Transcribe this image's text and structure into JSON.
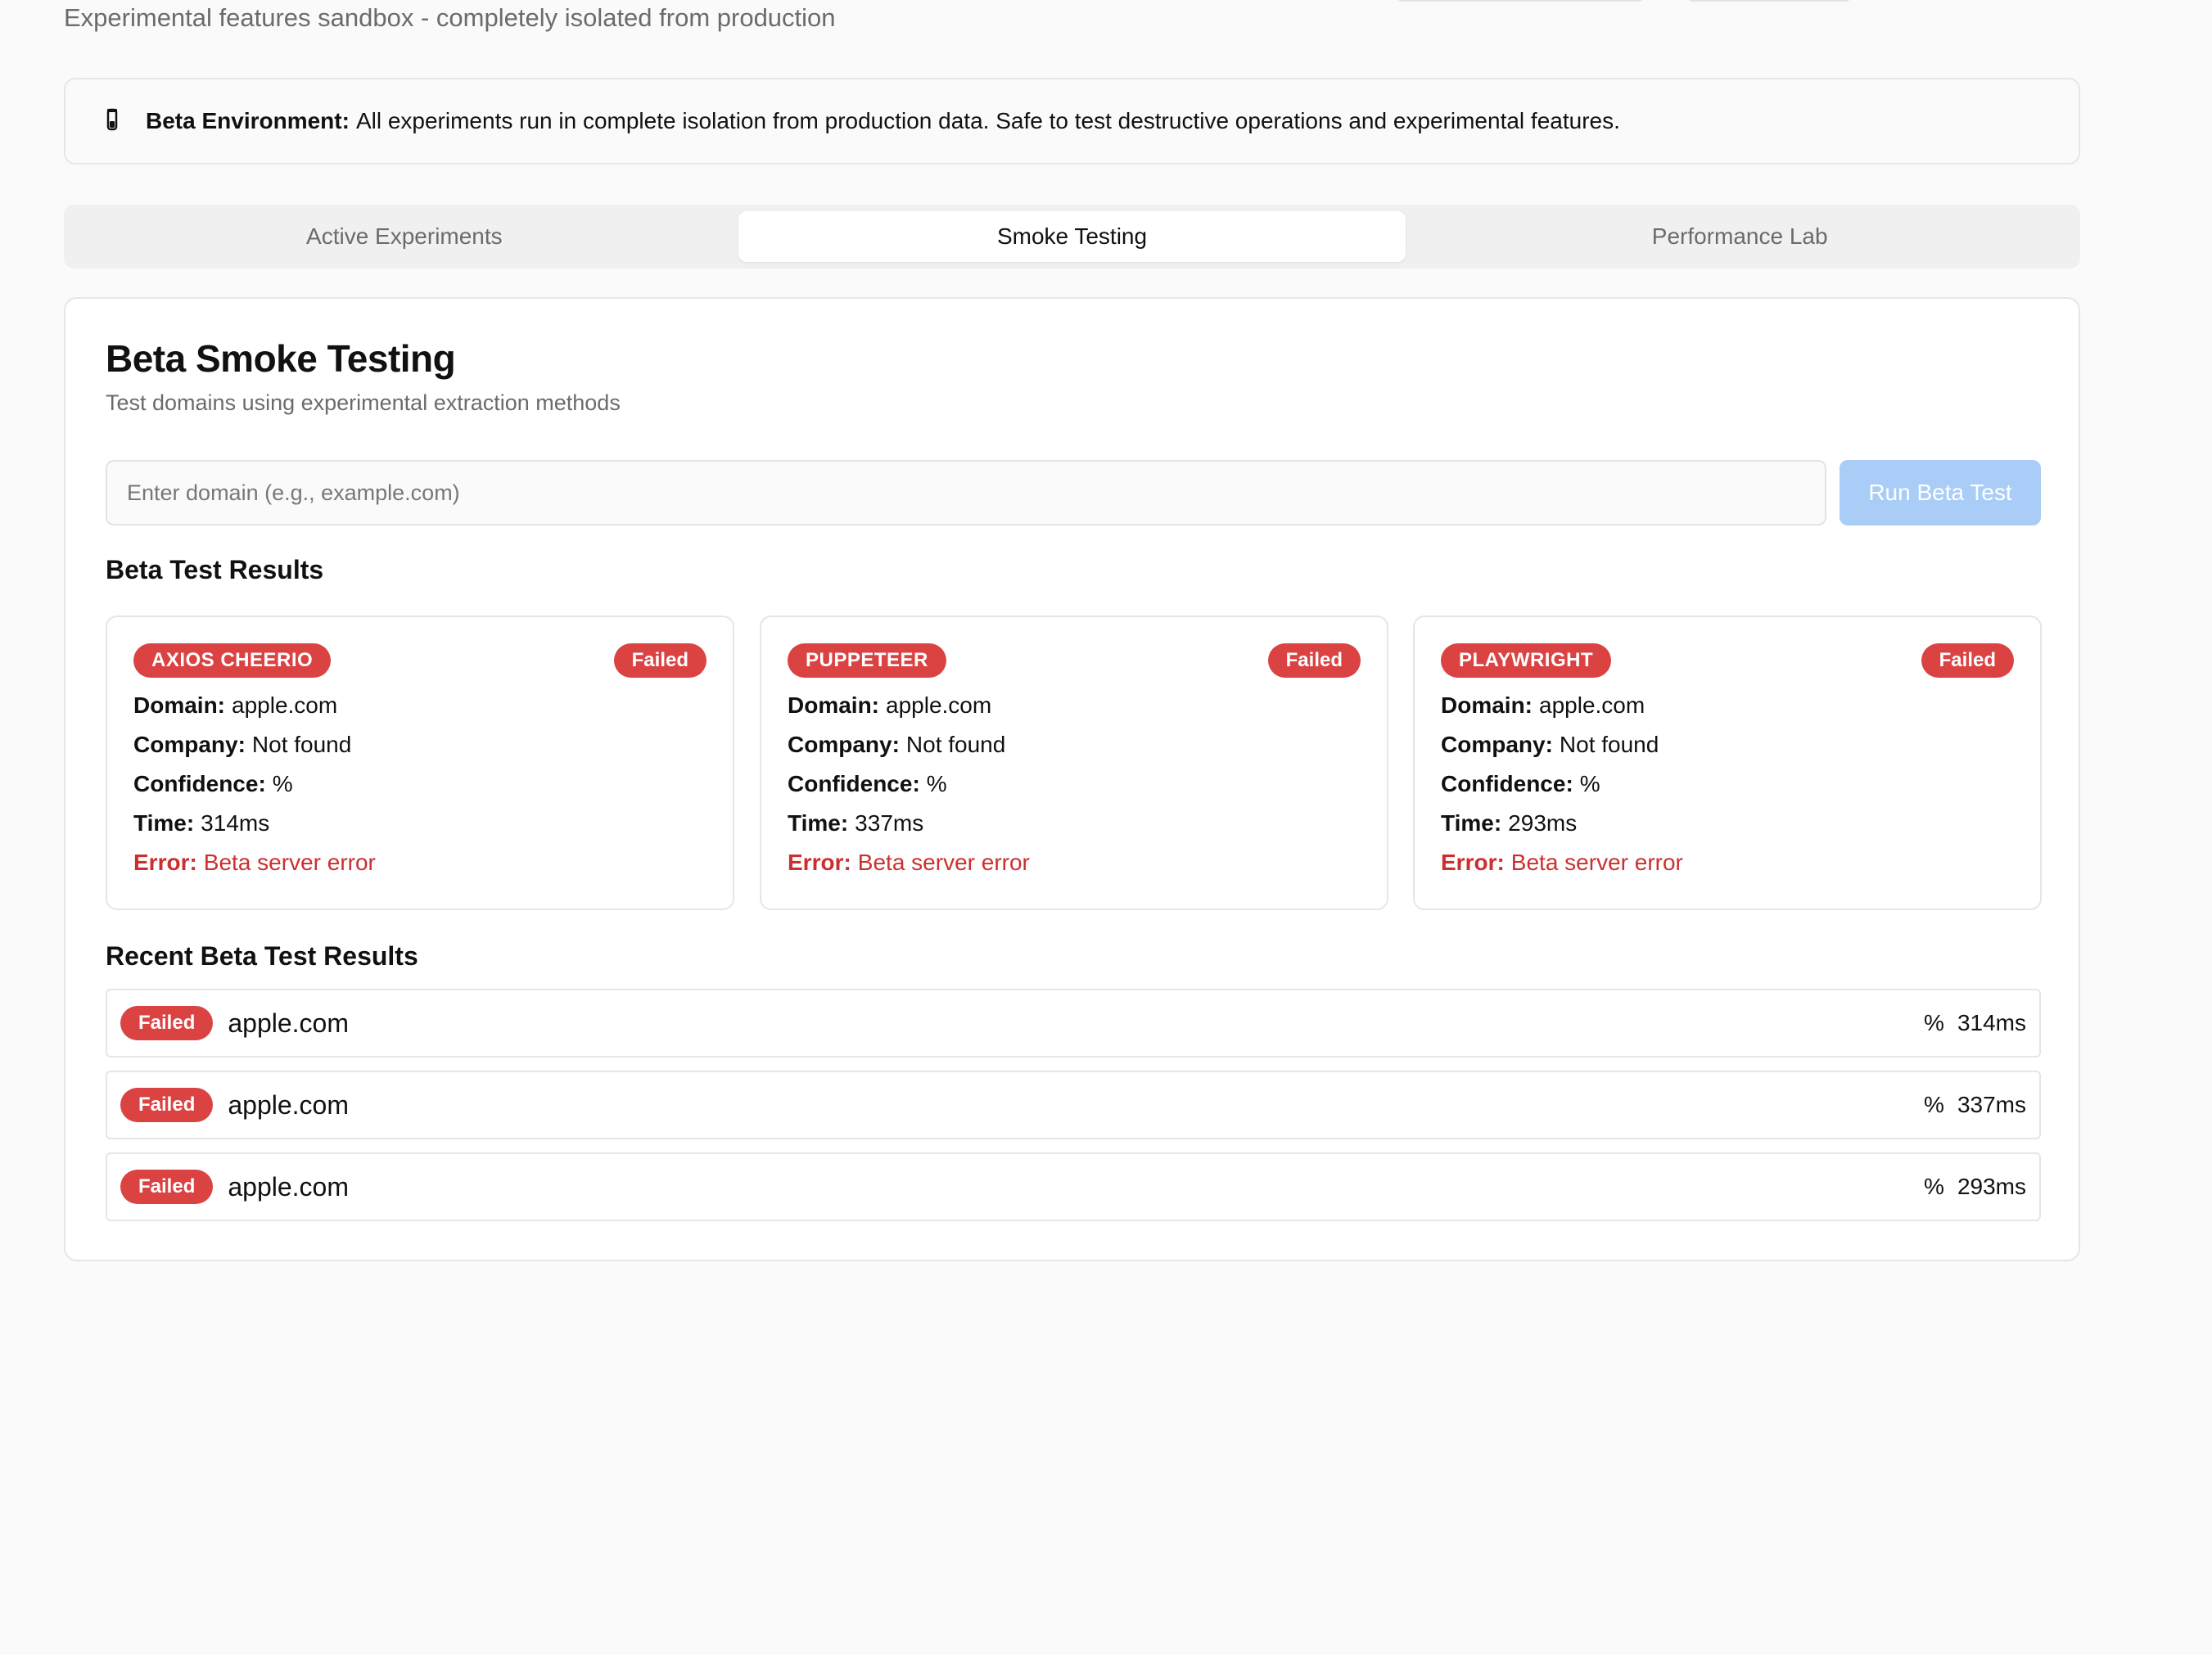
{
  "header": {
    "subtitle": "Experimental features sandbox - completely isolated from production"
  },
  "banner": {
    "icon": "flask-icon",
    "label": "Beta Environment:",
    "text": "All experiments run in complete isolation from production data. Safe to test destructive operations and experimental features."
  },
  "tabs": [
    {
      "label": "Active Experiments",
      "active": false
    },
    {
      "label": "Smoke Testing",
      "active": true
    },
    {
      "label": "Performance Lab",
      "active": false
    }
  ],
  "smoke": {
    "title": "Beta Smoke Testing",
    "description": "Test domains using experimental extraction methods",
    "input_placeholder": "Enter domain (e.g., example.com)",
    "run_button": "Run Beta Test",
    "results_heading": "Beta Test Results",
    "recent_heading": "Recent Beta Test Results",
    "field_labels": {
      "domain": "Domain:",
      "company": "Company:",
      "confidence": "Confidence:",
      "time": "Time:",
      "error": "Error:"
    },
    "results": [
      {
        "method": "AXIOS CHEERIO",
        "status": "Failed",
        "domain": "apple.com",
        "company": "Not found",
        "confidence": "%",
        "time": "314ms",
        "error": "Beta server error"
      },
      {
        "method": "PUPPETEER",
        "status": "Failed",
        "domain": "apple.com",
        "company": "Not found",
        "confidence": "%",
        "time": "337ms",
        "error": "Beta server error"
      },
      {
        "method": "PLAYWRIGHT",
        "status": "Failed",
        "domain": "apple.com",
        "company": "Not found",
        "confidence": "%",
        "time": "293ms",
        "error": "Beta server error"
      }
    ],
    "recent": [
      {
        "status": "Failed",
        "domain": "apple.com",
        "confidence": "%",
        "time": "314ms"
      },
      {
        "status": "Failed",
        "domain": "apple.com",
        "confidence": "%",
        "time": "337ms"
      },
      {
        "status": "Failed",
        "domain": "apple.com",
        "confidence": "%",
        "time": "293ms"
      }
    ]
  },
  "colors": {
    "failed": "#db4343",
    "error_text": "#cc2f2f",
    "run_button": "#a9cdf6",
    "background": "#fafafa"
  }
}
